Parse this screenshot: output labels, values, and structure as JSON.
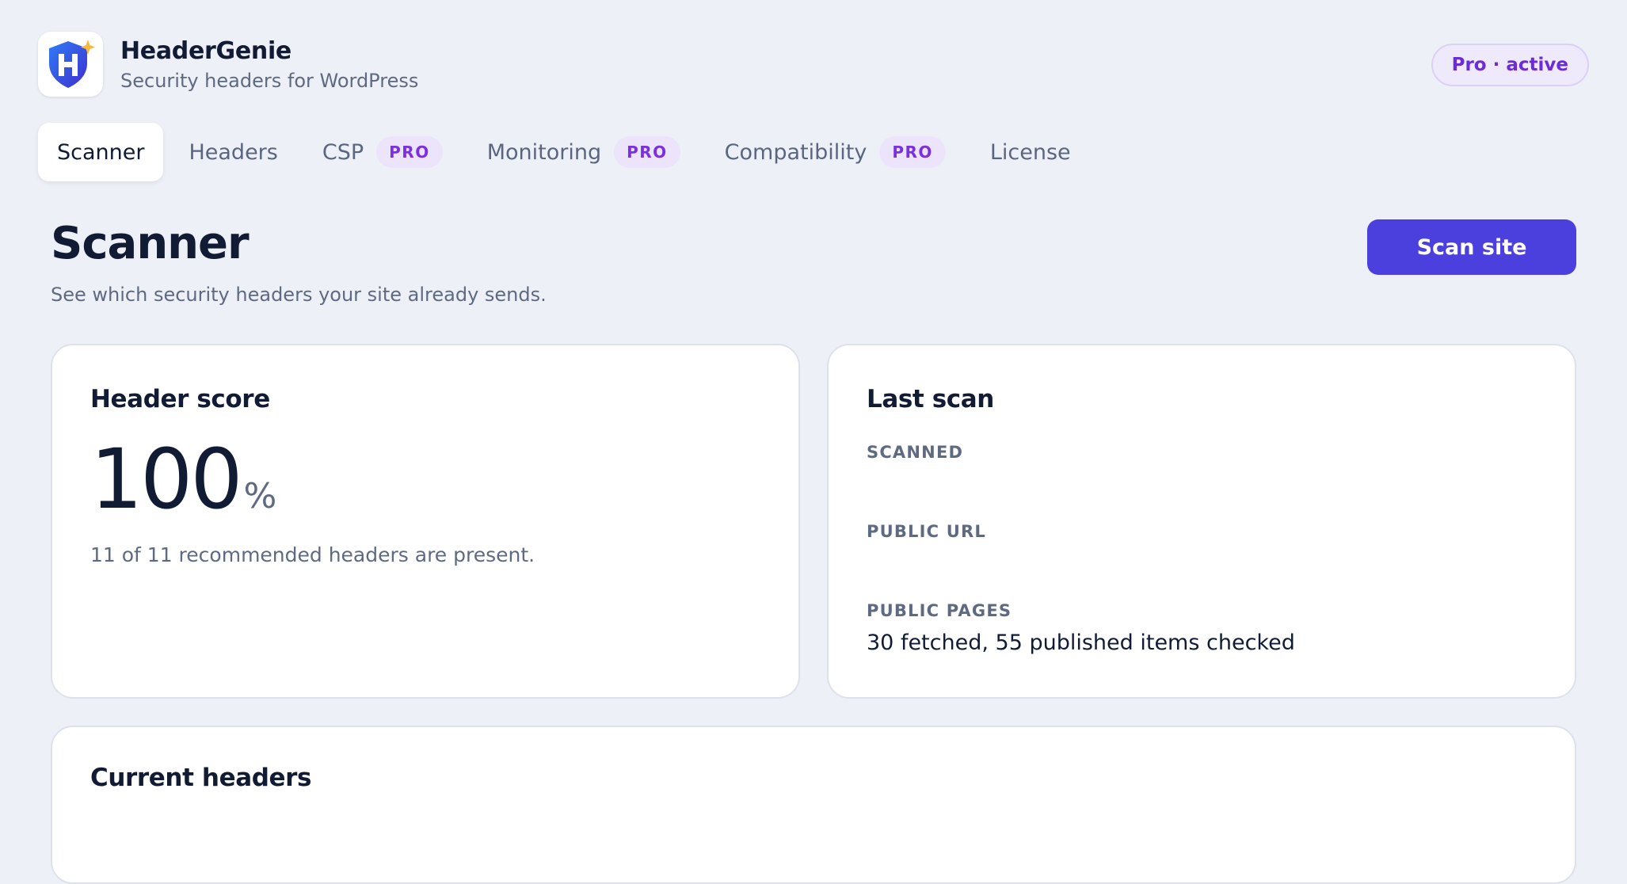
{
  "app": {
    "name": "HeaderGenie",
    "subtitle": "Security headers for WordPress",
    "logo_icon": "shield-logo-icon",
    "plan_badge": "Pro · active"
  },
  "tabs": [
    {
      "label": "Scanner",
      "active": true
    },
    {
      "label": "Headers"
    },
    {
      "label": "CSP",
      "badge": "PRO"
    },
    {
      "label": "Monitoring",
      "badge": "PRO"
    },
    {
      "label": "Compatibility",
      "badge": "PRO"
    },
    {
      "label": "License"
    }
  ],
  "page": {
    "title": "Scanner",
    "subtitle": "See which security headers your site already sends.",
    "scan_button": "Scan site"
  },
  "score_card": {
    "title": "Header score",
    "value": "100",
    "unit": "%",
    "description": "11 of 11 recommended headers are present."
  },
  "last_scan": {
    "title": "Last scan",
    "scanned_label": "SCANNED",
    "scanned_value": "",
    "public_url_label": "PUBLIC URL",
    "public_url_value": "",
    "public_pages_label": "PUBLIC PAGES",
    "public_pages_value": "30 fetched, 55 published items checked"
  },
  "current_headers": {
    "title": "Current headers"
  },
  "colors": {
    "accent": "#4b3fde",
    "pro": "#7a30e0",
    "background": "#eef0f7"
  }
}
